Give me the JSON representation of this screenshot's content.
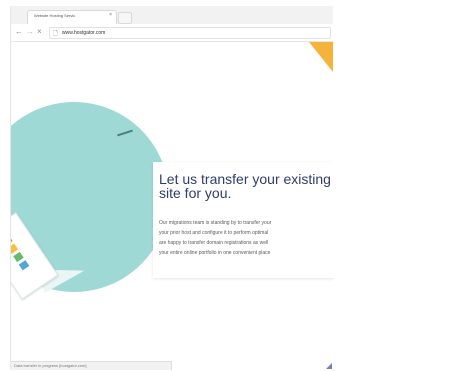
{
  "browser": {
    "tab_title": "Website Hosting Servic",
    "tab_close": "×",
    "nav": {
      "back": "←",
      "forward": "→",
      "reload": "×"
    },
    "page_icon": "🗋",
    "url": "www.hostgator.com",
    "status_text": "Data transfer in progress [hostgator.com]"
  },
  "page": {
    "headline": "Let us transfer your existing site for you.",
    "body_lines": [
      "Our migrations team is standing by to transfer your",
      "your prior host and configure it to perform optimal",
      "are happy to transfer domain registrations as well",
      "your entire online portfolio in one convenient place"
    ]
  },
  "colors": {
    "teal": "#9fd9d6",
    "navy": "#2f3d6b",
    "accent_orange": "#f6b33c"
  },
  "icons": [
    "back-arrow-icon",
    "forward-arrow-icon",
    "reload-icon",
    "page-icon",
    "close-icon"
  ]
}
